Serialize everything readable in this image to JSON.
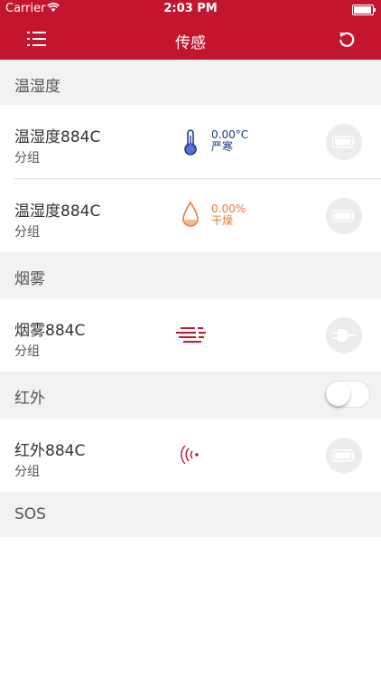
{
  "status_bar": {
    "carrier": "Carrier",
    "time": "2:03 PM"
  },
  "nav": {
    "title": "传感"
  },
  "colors": {
    "brand": "#c3162e",
    "temperature": "#1a3a8c",
    "humidity": "#f0773a",
    "section_bg": "#f2f2f2"
  },
  "sections": [
    {
      "label": "温湿度"
    },
    {
      "label": "烟雾"
    },
    {
      "label": "红外",
      "toggle_on": false
    },
    {
      "label": "SOS"
    }
  ],
  "devices": [
    {
      "name": "温湿度884C",
      "group": "分组",
      "icon": "thermometer-icon",
      "value": "0.00°C",
      "status": "严寒",
      "action_icon": "battery-icon"
    },
    {
      "name": "温湿度884C",
      "group": "分组",
      "icon": "water-drop-icon",
      "value": "0.00%",
      "status": "干燥",
      "action_icon": "battery-icon"
    },
    {
      "name": "烟雾884C",
      "group": "分组",
      "icon": "smoke-icon",
      "action_icon": "plug-icon"
    },
    {
      "name": "红外884C",
      "group": "分组",
      "icon": "infrared-signal-icon",
      "action_icon": "battery-icon"
    }
  ]
}
